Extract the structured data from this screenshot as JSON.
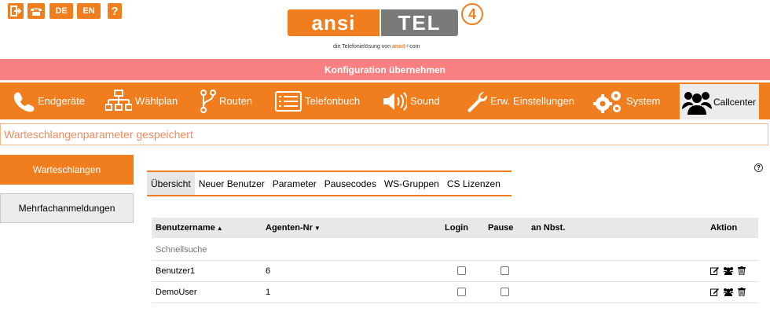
{
  "top_icons": [
    {
      "name": "logout-icon"
    },
    {
      "name": "phone-icon"
    },
    {
      "name": "lang-de-button",
      "label": "DE"
    },
    {
      "name": "lang-en-button",
      "label": "EN"
    },
    {
      "name": "help-icon",
      "label": "?"
    }
  ],
  "logo": {
    "left": "ansi",
    "right": "TEL",
    "version": "4",
    "tagline_prefix": "die Telefonielösung von ",
    "tagline_brand": "ansit",
    "tagline_suffix": "com"
  },
  "apply_bar": "Konfiguration übernehmen",
  "nav": {
    "endgeraete": "Endgeräte",
    "waehlplan": "Wählplan",
    "routen": "Routen",
    "telefonbuch": "Telefonbuch",
    "sound": "Sound",
    "erw": "Erw. Einstellungen",
    "system": "System",
    "callcenter": "Callcenter"
  },
  "status_message": "Warteschlangenparameter gespeichert",
  "side_menu": {
    "warteschlangen": "Warteschlangen",
    "mehrfach": "Mehrfachanmeldungen"
  },
  "tabs": [
    "Übersicht",
    "Neuer Benutzer",
    "Parameter",
    "Pausecodes",
    "WS-Gruppen",
    "CS Lizenzen"
  ],
  "help_label": "?",
  "table": {
    "headers": {
      "user": "Benutzername",
      "agent": "Agenten-Nr",
      "login": "Login",
      "pause": "Pause",
      "nbst": "an Nbst.",
      "action": "Aktion"
    },
    "search_placeholder": "Schnellsuche",
    "rows": [
      {
        "user": "Benutzer1",
        "agent": "6",
        "login": false,
        "pause": false
      },
      {
        "user": "DemoUser",
        "agent": "1",
        "login": false,
        "pause": false
      }
    ]
  },
  "colors": {
    "accent": "#f07d1e",
    "apply": "#f98080",
    "status_text": "#f08a5d"
  }
}
